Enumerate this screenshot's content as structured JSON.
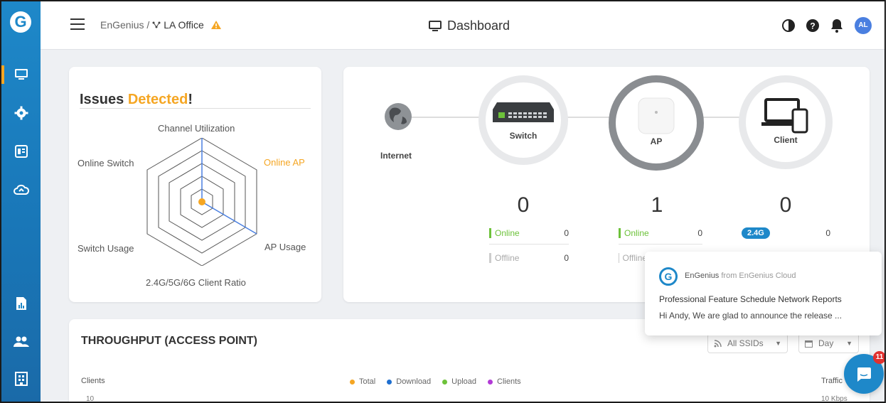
{
  "header": {
    "breadcrumb_org": "EnGenius /",
    "breadcrumb_site": "LA Office",
    "warning_icon": "warning-triangle-icon",
    "page_title": "Dashboard",
    "avatar_initials": "AL"
  },
  "sidebar": {
    "logo": "G",
    "items": [
      {
        "name": "dashboard",
        "icon": "monitor-icon"
      },
      {
        "name": "settings",
        "icon": "gear-icon"
      },
      {
        "name": "devices",
        "icon": "device-list-icon"
      },
      {
        "name": "cloud",
        "icon": "cloud-sync-icon"
      },
      {
        "name": "reports",
        "icon": "report-icon"
      },
      {
        "name": "users",
        "icon": "users-icon"
      },
      {
        "name": "organization",
        "icon": "building-icon"
      }
    ]
  },
  "issues": {
    "title_prefix": "Issues ",
    "title_accent": "Detected",
    "title_suffix": "!",
    "axes": {
      "top": "Channel Utilization",
      "top_right": "Online AP",
      "bottom_right": "AP Usage",
      "bottom": "2.4G/5G/6G Client Ratio",
      "bottom_left": "Switch Usage",
      "top_left": "Online Switch"
    }
  },
  "topology": {
    "internet": {
      "label": "Internet"
    },
    "switch": {
      "label": "Switch",
      "count": "0",
      "online_label": "Online",
      "online": "0",
      "offline_label": "Offline",
      "offline": "0"
    },
    "ap": {
      "label": "AP",
      "count": "1",
      "online_label": "Online",
      "online": "0",
      "offline_label": "Offline"
    },
    "client": {
      "label": "Client",
      "count": "0",
      "band": "2.4G",
      "band_count": "0"
    }
  },
  "throughput": {
    "title": "THROUGHPUT (ACCESS POINT)",
    "ssid_select": "All SSIDs",
    "range_select": "Day",
    "y_left_label": "Clients",
    "y_left_tick": "10",
    "y_right_label": "Traffic",
    "y_right_tick": "10 Kbps",
    "legend": [
      {
        "label": "Total",
        "color": "#f5a623"
      },
      {
        "label": "Download",
        "color": "#1e6fd0"
      },
      {
        "label": "Upload",
        "color": "#6dc23a"
      },
      {
        "label": "Clients",
        "color": "#b23ad6"
      }
    ]
  },
  "notification": {
    "sender": "EnGenius",
    "sender_suffix": " from EnGenius Cloud",
    "subject": "Professional Feature Schedule Network Reports",
    "preview": "Hi Andy, We are glad to announce the release ...",
    "badge_count": "11"
  },
  "colors": {
    "brand": "#1e88c9",
    "accent": "#f5a623",
    "online": "#6dc23a"
  }
}
